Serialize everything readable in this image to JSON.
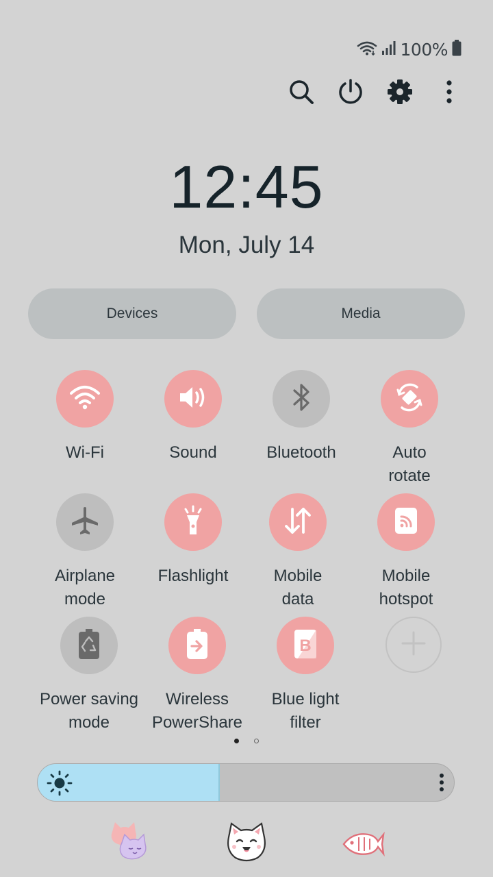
{
  "status_bar": {
    "battery_text": "100%",
    "icons": [
      "wifi-icon",
      "signal-icon",
      "battery-icon"
    ]
  },
  "toolbar": {
    "icons": [
      "search-icon",
      "power-icon",
      "gear-icon",
      "more-vertical-icon"
    ]
  },
  "clock": {
    "time": "12:45",
    "date": "Mon, July 14"
  },
  "pills": {
    "devices_label": "Devices",
    "media_label": "Media"
  },
  "tiles": [
    {
      "label": "Wi-Fi",
      "icon": "wifi-icon",
      "state": "on"
    },
    {
      "label": "Sound",
      "icon": "speaker-icon",
      "state": "on"
    },
    {
      "label": "Bluetooth",
      "icon": "bluetooth-icon",
      "state": "off"
    },
    {
      "label": "Auto\nrotate",
      "icon": "auto-rotate-icon",
      "state": "on"
    },
    {
      "label": "Airplane\nmode",
      "icon": "airplane-icon",
      "state": "off"
    },
    {
      "label": "Flashlight",
      "icon": "flashlight-icon",
      "state": "on"
    },
    {
      "label": "Mobile\ndata",
      "icon": "mobile-data-icon",
      "state": "on"
    },
    {
      "label": "Mobile\nhotspot",
      "icon": "hotspot-icon",
      "state": "on"
    },
    {
      "label": "Power saving\nmode",
      "icon": "power-saving-icon",
      "state": "off"
    },
    {
      "label": "Wireless\nPowerShare",
      "icon": "wireless-powershare-icon",
      "state": "on"
    },
    {
      "label": "Blue light\nfilter",
      "icon": "blue-light-filter-icon",
      "state": "on"
    },
    {
      "label": "",
      "icon": "plus-icon",
      "state": "add"
    }
  ],
  "pagination": {
    "pages": 2,
    "current": 1
  },
  "brightness": {
    "level": 0.435
  },
  "colors": {
    "background": "#d3d3d3",
    "tile_on": "#f0a3a3",
    "tile_off": "#bebebe",
    "brightness_fill": "#aee0f4"
  },
  "theme_icons": [
    "cats-icon",
    "cat-face-icon",
    "fish-icon"
  ]
}
